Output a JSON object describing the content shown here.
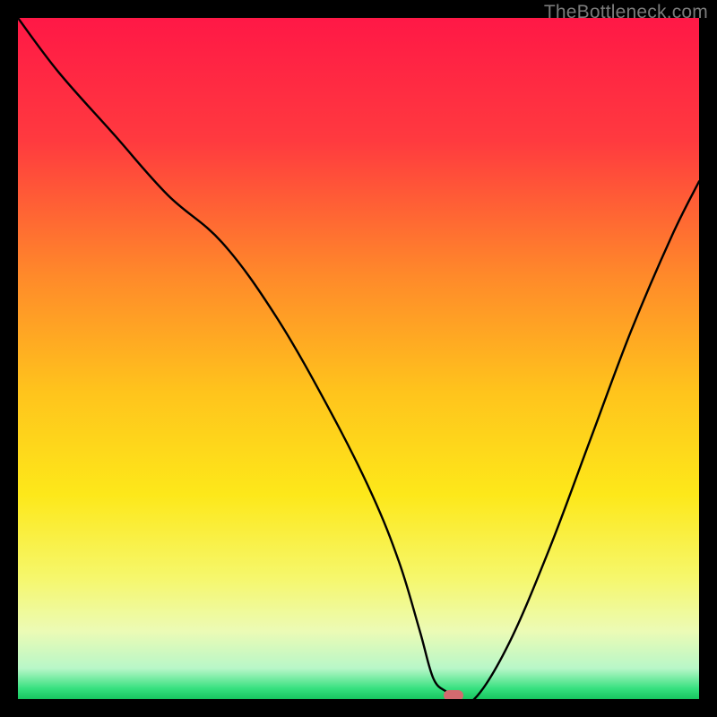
{
  "watermark": "TheBottleneck.com",
  "chart_data": {
    "type": "line",
    "title": "",
    "xlabel": "",
    "ylabel": "",
    "xlim": [
      0,
      100
    ],
    "ylim": [
      0,
      100
    ],
    "grid": false,
    "legend": false,
    "background": {
      "type": "vertical-gradient",
      "stops": [
        {
          "pos": 0.0,
          "color": "#ff1846"
        },
        {
          "pos": 0.18,
          "color": "#ff3a3f"
        },
        {
          "pos": 0.38,
          "color": "#ff8a2a"
        },
        {
          "pos": 0.55,
          "color": "#ffc41c"
        },
        {
          "pos": 0.7,
          "color": "#fde81a"
        },
        {
          "pos": 0.82,
          "color": "#f6f76a"
        },
        {
          "pos": 0.9,
          "color": "#ecfbb5"
        },
        {
          "pos": 0.955,
          "color": "#b8f7c8"
        },
        {
          "pos": 0.985,
          "color": "#35e07e"
        },
        {
          "pos": 1.0,
          "color": "#17c55f"
        }
      ]
    },
    "series": [
      {
        "name": "bottleneck-curve",
        "color": "#000000",
        "x": [
          0,
          6,
          14,
          22,
          30,
          38,
          46,
          52,
          56,
          59,
          61,
          63,
          64,
          67,
          72,
          78,
          84,
          90,
          96,
          100
        ],
        "y": [
          100,
          92,
          83,
          74,
          67,
          56,
          42,
          30,
          20,
          10,
          3,
          1,
          0,
          0,
          8,
          22,
          38,
          54,
          68,
          76
        ]
      }
    ],
    "marker": {
      "x": 64,
      "y": 0.5,
      "color": "#d36a6f"
    }
  }
}
